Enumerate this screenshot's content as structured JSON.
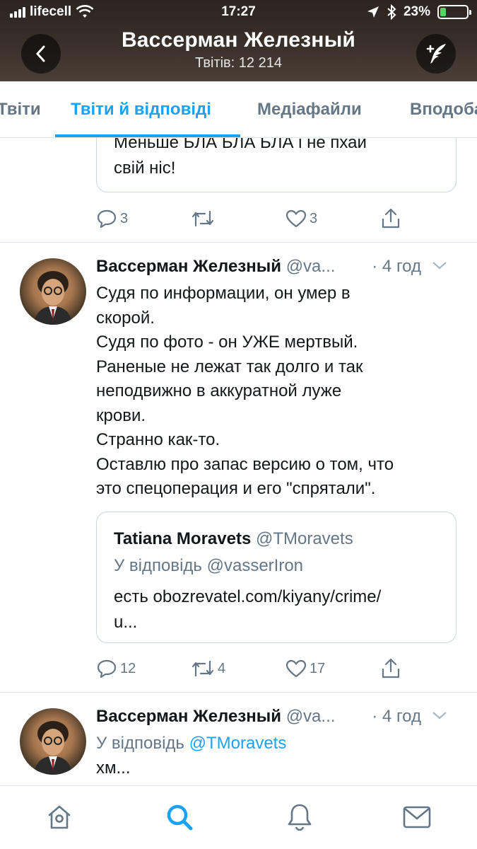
{
  "status_bar": {
    "carrier": "lifecell",
    "time": "17:27",
    "battery": "23%",
    "battery_level": 0.23
  },
  "header": {
    "title": "Вассерман Железный",
    "subtitle": "Твітів: 12 214"
  },
  "tabs": [
    {
      "label": "Твіти"
    },
    {
      "label": "Твіти й відповіді",
      "active": true
    },
    {
      "label": "Медіафайли"
    },
    {
      "label": "Вподобання"
    }
  ],
  "tweet0": {
    "quote_text_line1": "Меньше БЛА БЛА БЛА і не пхай",
    "quote_text_line2": "свій ніс!",
    "replies": "3",
    "retweets": "",
    "likes": "3"
  },
  "tweet1": {
    "author": "Вассерман Железный",
    "handle": "@va...",
    "time": "· 4 год",
    "lines": [
      "Судя по информации, он умер в",
      "скорой.",
      "Судя по фото - он УЖЕ мертвый.",
      "Раненые не лежат так долго и так",
      "неподвижно в аккуратной луже",
      "крови.",
      "Странно как-то.",
      "Оставлю про запас версию о том, что",
      "это спецоперация и его \"спрятали\"."
    ],
    "quote": {
      "author": "Tatiana Moravets",
      "handle": "@TMoravets",
      "reply_to": "У відповідь @vasserIron",
      "text_line1": "есть obozrevatel.com/kiyany/crime/",
      "text_line2": "u..."
    },
    "replies": "12",
    "retweets": "4",
    "likes": "17"
  },
  "tweet2": {
    "author": "Вассерман Железный",
    "handle": "@va...",
    "time": "· 4 год",
    "reply_prefix": "У відповідь",
    "reply_handle": "@TMoravets",
    "text": "хм..."
  },
  "colors": {
    "accent": "#1da1f2",
    "muted": "#657786",
    "border": "#e1e8ed"
  }
}
